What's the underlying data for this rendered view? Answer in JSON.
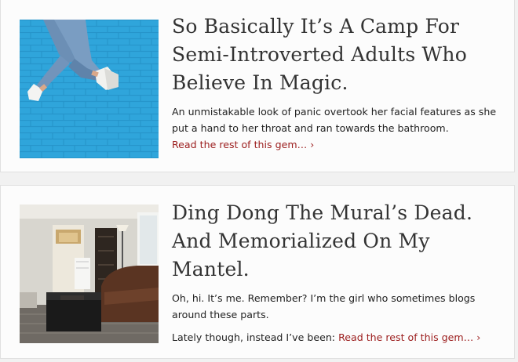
{
  "posts": [
    {
      "title": "So Basically It’s A Camp For Semi-Introverted Adults Who Believe In Magic.",
      "excerpt": "An unmistakable look of panic overtook her facial features as she put a hand to her throat and ran towards the bathroom.",
      "read_more": "Read the rest of this gem… ›",
      "image_icon": "photo-jumping-person-icon"
    },
    {
      "title": "Ding Dong The Mural’s Dead. And Memorialized On My Mantel.",
      "excerpt_p1": "Oh, hi. It’s me. Remember? I’m the girl who sometimes blogs around these parts.",
      "excerpt_p2": "Lately though, instead I’ve been:",
      "read_more": "Read the rest of this gem… ›",
      "image_icon": "photo-living-room-icon"
    }
  ],
  "colors": {
    "page_bg": "#f1f1f1",
    "card_bg": "#fcfcfc",
    "title": "#333333",
    "text": "#222222",
    "link": "#9b1c1c",
    "wall_blue": "#2aa3d8"
  }
}
